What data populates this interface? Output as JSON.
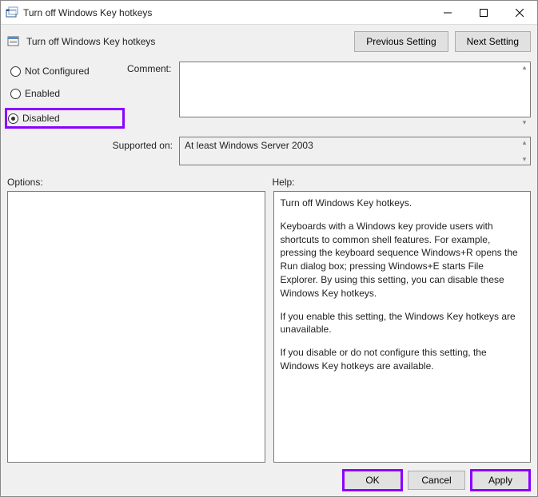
{
  "window": {
    "title": "Turn off Windows Key hotkeys"
  },
  "header": {
    "title": "Turn off Windows Key hotkeys",
    "prev_btn": "Previous Setting",
    "next_btn": "Next Setting"
  },
  "radios": {
    "not_configured": "Not Configured",
    "enabled": "Enabled",
    "disabled": "Disabled",
    "selected": "disabled"
  },
  "labels": {
    "comment": "Comment:",
    "supported_on": "Supported on:",
    "options": "Options:",
    "help": "Help:"
  },
  "comment_value": "",
  "supported_on": "At least Windows Server 2003",
  "help": {
    "p1": "Turn off Windows Key hotkeys.",
    "p2": "Keyboards with a Windows key provide users with shortcuts to common shell features. For example, pressing the keyboard sequence Windows+R opens the Run dialog box; pressing Windows+E starts File Explorer. By using this setting, you can disable these Windows Key hotkeys.",
    "p3": "If you enable this setting, the Windows Key hotkeys are unavailable.",
    "p4": "If you disable or do not configure this setting, the Windows Key hotkeys are available."
  },
  "buttons": {
    "ok": "OK",
    "cancel": "Cancel",
    "apply": "Apply"
  }
}
